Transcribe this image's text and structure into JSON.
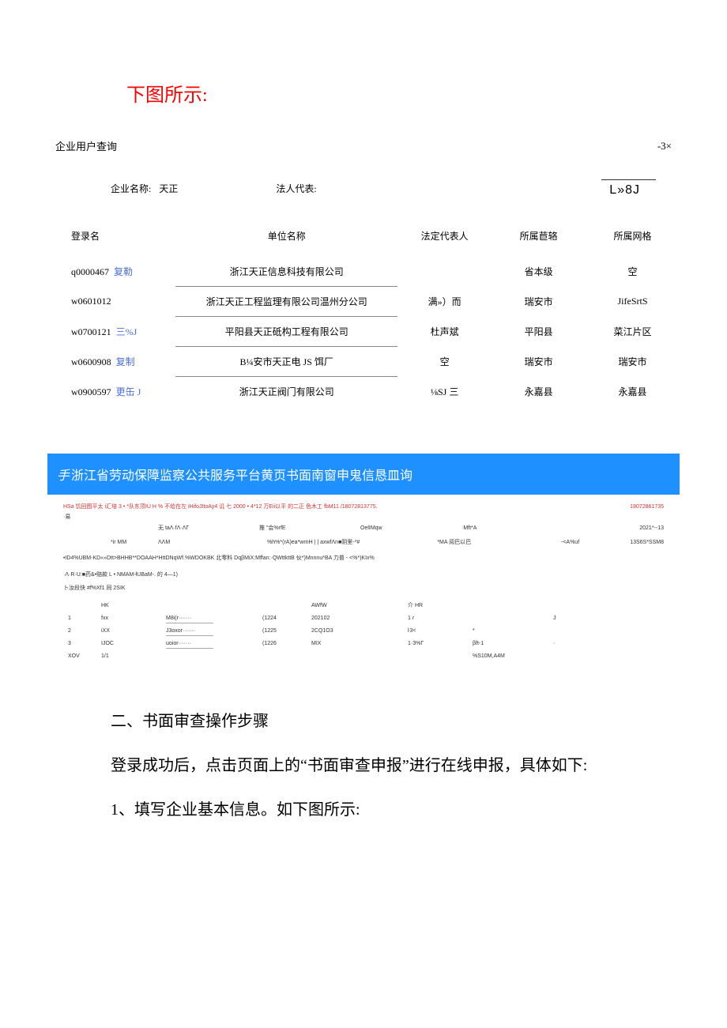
{
  "heading_red": "下图所示:",
  "dialog": {
    "title": "企业用户查询",
    "close": "-3×",
    "search": {
      "label_name": "企业名称:",
      "value_name": "天正",
      "label_rep": "法人代表:",
      "value_rep": "",
      "box_right": "L»8J"
    },
    "cols": {
      "login": "登录名",
      "unit": "单位名称",
      "rep": "法定代表人",
      "area": "所属苣辂",
      "grid": "所属网格"
    },
    "rows": [
      {
        "login": "q0000467",
        "copy": "复勒",
        "unit": "浙江天正信息科技有限公司",
        "rep": "",
        "area": "省本级",
        "grid": "空"
      },
      {
        "login": "w0601012",
        "copy": "",
        "unit": "浙江天正工程监理有限公司温州分公司",
        "rep": "满»）而",
        "area": "瑞安市",
        "grid": "JifeSrtS"
      },
      {
        "login": "w0700121",
        "copy": "三%J",
        "unit": "平阳县天正砥构工程有限公司",
        "rep": "杜声斌",
        "area": "平阳县",
        "grid": "菜江片区"
      },
      {
        "login": "w0600908",
        "copy": "复制",
        "unit": "B¼安市天正电 JS 饵厂",
        "rep": "空",
        "area": "瑞安市",
        "grid": "瑞安市"
      },
      {
        "login": "w0900597",
        "copy": "更缶 J",
        "unit": "浙江天正阀门有限公司",
        "rep": "⅛SJ 三",
        "area": "永嘉县",
        "grid": "永嘉县"
      }
    ]
  },
  "banner": "浙江省劳动保障监察公共服务平台黄页书面南窗申鬼信恳皿询",
  "tiny": {
    "line1_a": "HSa 饥田图平太  i汇培 3 • *队东顶IÙ H % 不给在左 iHifoJItoAy4 讥 七 2000 • 4*12 万Eii以平 的二正 色木工 fbM11 /18072813775.",
    "line1_b": "18072861735",
    "line2": "·易",
    "row_a": {
      "c1": "无 taΛ·fΛ·ΛΓ",
      "c2": "推 \"会%rfE",
      "c3": "OelIMqw",
      "c4": "·Mft*A",
      "c5": "2021*--13"
    },
    "row_b": {
      "c1": "*ir MM",
      "c2": "ΛΛM",
      "c3": "%h%*(rA)ea*wrnH |  | axwfΛn■阴里-*#",
      "c4": "*MA 阅巴以巴",
      "c5": "-<A%uf",
      "c6": "13S6S*SSM8"
    },
    "long1": "•ID4%UBM-KD«»Dtt>BHHB**DOAAH*HttDNqWf.%WDOKBK 北零料 DqβMiX:Mffan:·QWttkttB 伙*)Mnnnu*BA 力普 - <%*)KIx%",
    "long2": "·Λ·R·U:■药&•赔款 L • NMAM-łUBaM-. 的 4—1)",
    "long3": "卜汝段快 #f%Xf1 同 2SIK",
    "table": {
      "h": [
        "",
        "HK",
        "",
        "",
        "AWfW",
        "介 HR",
        "",
        ""
      ],
      "r1": [
        "1",
        "fxx",
        "M8i(r·······",
        "(1224",
        "202102",
        "1 ɾ",
        "",
        "J"
      ],
      "r2": [
        "2",
        "iXX",
        "J3oxor·······",
        "(1225",
        "2CQ1O3",
        "ŀ3<",
        "*",
        ""
      ],
      "r3": [
        "3",
        "IJOC",
        "uoior·······",
        "(1226",
        "MIX",
        "1·3%Г",
        "βft-1",
        "·"
      ],
      "r4": [
        "XOV",
        "1/1",
        "",
        "",
        "",
        "",
        "%S10M,A4M",
        ""
      ]
    }
  },
  "section2_title": "二、书面审查操作步骤",
  "section2_p1": "登录成功后，点击页面上的“书面审查申报”进行在线申报，具体如下:",
  "section2_p2": "1、填写企业基本信息。如下图所示:"
}
